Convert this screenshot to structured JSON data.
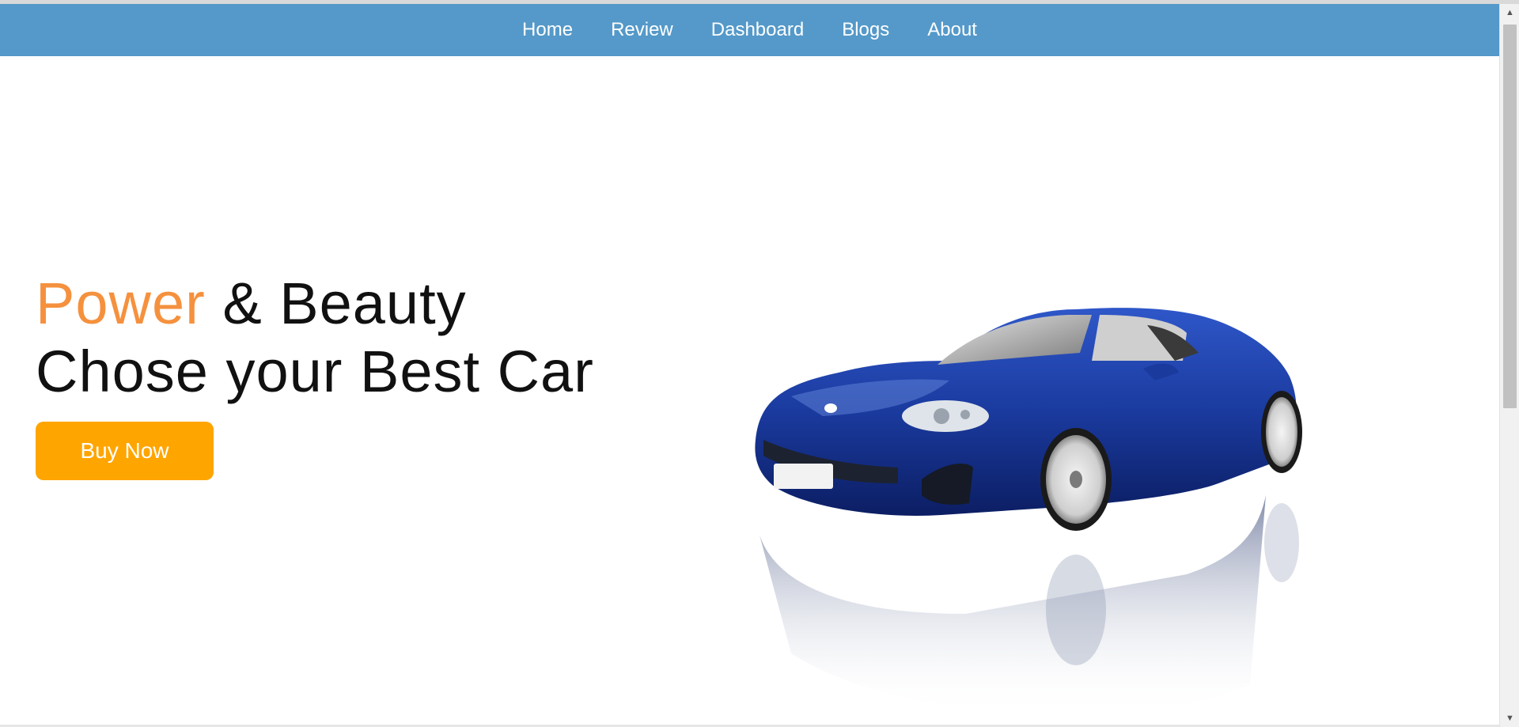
{
  "nav": {
    "items": [
      {
        "label": "Home"
      },
      {
        "label": "Review"
      },
      {
        "label": "Dashboard"
      },
      {
        "label": "Blogs"
      },
      {
        "label": "About"
      }
    ]
  },
  "hero": {
    "headline_accent": "Power",
    "headline_rest": " & Beauty",
    "headline_line2": "Chose your Best Car",
    "cta_label": "Buy Now"
  },
  "colors": {
    "navbar": "#5499c9",
    "accent": "#f5913e",
    "cta": "#ffa500",
    "car_body": "#1a3a9e"
  },
  "icons": {
    "scroll_up": "triangle-up-icon",
    "scroll_down": "triangle-down-icon"
  }
}
